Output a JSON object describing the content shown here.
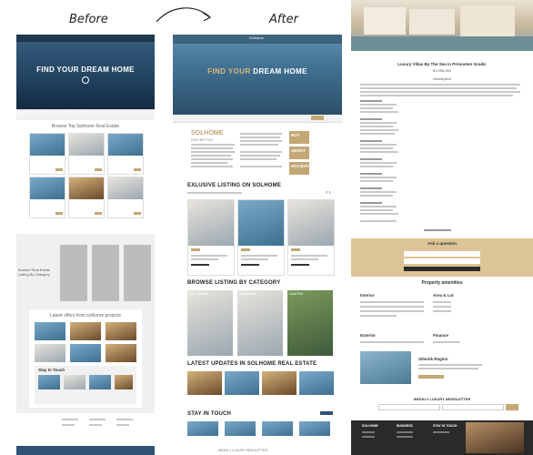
{
  "labels": {
    "before": "Before",
    "after": "After"
  },
  "before": {
    "hero_title": "FIND YOUR DREAM HOME",
    "section_browse": "Browse Top Solhome Real Estate",
    "side_text": "Browse Real Estate Listing By Category",
    "section_latest": "Latest offers from solhome projects",
    "stay_title": "Stay In Touch"
  },
  "after": {
    "brand": "Solhome",
    "hero_title_a": "FIND YOUR",
    "hero_title_b": "DREAM HOME",
    "solhome_heading": "SOLHOME",
    "solhome_sub": "DESCRIPTION",
    "btn_buy": "BUY",
    "btn_about": "ABOUT",
    "btn_holidays": "HOLIDAYS",
    "exclusive": "EXLUSIVE LISTING ON SOLHOME",
    "browse": "BROWSE LISTING BY CATEGORY",
    "cat1": "Villa / Ninova",
    "cat2": "Apartments",
    "cat3": "Land Plot",
    "updates": "LATEST UPDATES IN SOLHOME REAL ESTATE",
    "stay": "STAY IN TOUCH",
    "newsletter": "WEEKLY LUXURY NEWSLETTER"
  },
  "right": {
    "title": "Luxury Villas By The Sea in Primosten Gradic",
    "price": "€1,095,000",
    "description": "Description",
    "ask": "Ask a question",
    "amenities": "Property amenities",
    "interior": "Interior",
    "area": "Area & Lot",
    "exterior": "Exterior",
    "finance": "Finance",
    "region": "Sibenik Region",
    "newsletter": "WEEKLY LUXURY NEWSLETTER",
    "footer_cols": [
      "SOLHOME",
      "BUSINESS",
      "STAY IN TOUCH"
    ]
  }
}
